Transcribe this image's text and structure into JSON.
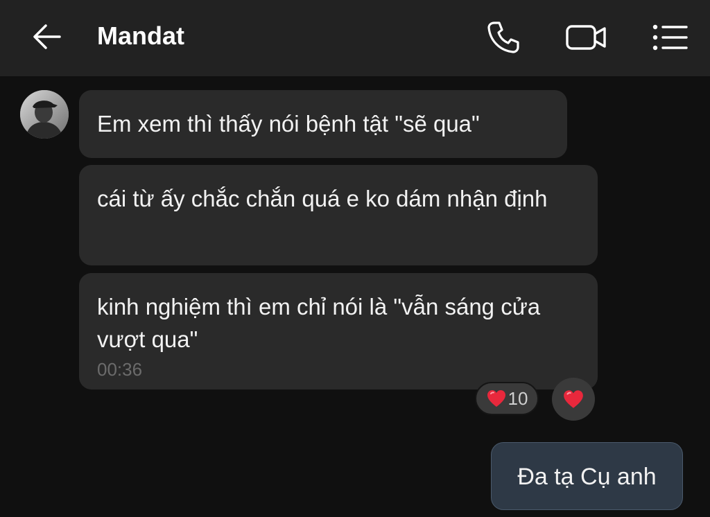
{
  "header": {
    "title": "Mandat",
    "back_icon": "arrow-left-icon",
    "call_icon": "phone-icon",
    "video_icon": "video-camera-icon",
    "menu_icon": "list-menu-icon"
  },
  "messages": {
    "incoming": [
      {
        "text": "Em xem thì thấy nói bệnh tật \"sẽ qua\""
      },
      {
        "text": "cái từ ấy chắc chắn quá e ko dám nhận định"
      },
      {
        "text": "kinh nghiệm thì em chỉ nói là \"vẫn sáng cửa vượt qua\"",
        "time": "00:36"
      }
    ],
    "reaction": {
      "icon": "heart-icon",
      "count": "10"
    },
    "outgoing": [
      {
        "text": "Đa tạ Cụ anh"
      }
    ]
  },
  "colors": {
    "background": "#101010",
    "header": "#222222",
    "incoming_bubble": "#2a2a2a",
    "outgoing_bubble": "#2e3946",
    "heart": "#e8283c"
  }
}
